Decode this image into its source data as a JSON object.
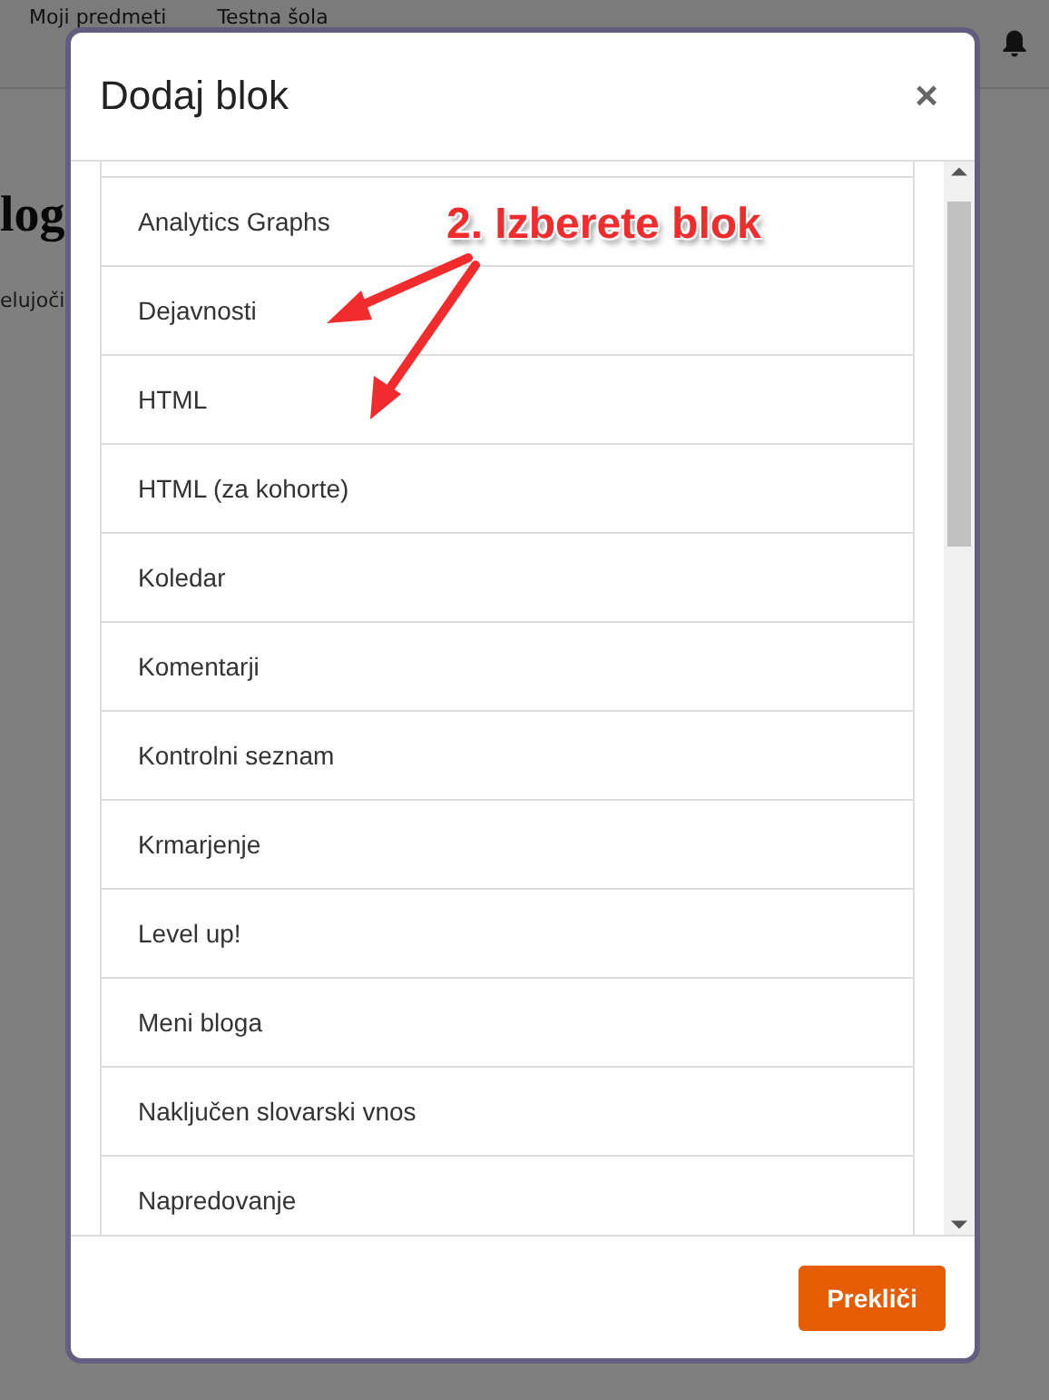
{
  "page": {
    "breadcrumb": [
      "Moji predmeti",
      "Testna šola"
    ],
    "heading": "log",
    "subtext": "elujoči"
  },
  "modal": {
    "title": "Dodaj blok",
    "close": "×",
    "blocks": [
      {
        "label": "Analytics Graphs"
      },
      {
        "label": "Dejavnosti"
      },
      {
        "label": "HTML"
      },
      {
        "label": "HTML (za kohorte)"
      },
      {
        "label": "Koledar"
      },
      {
        "label": "Komentarji"
      },
      {
        "label": "Kontrolni seznam"
      },
      {
        "label": "Krmarjenje"
      },
      {
        "label": "Level up!"
      },
      {
        "label": "Meni bloga"
      },
      {
        "label": "Naključen slovarski vnos"
      },
      {
        "label": "Napredovanje"
      }
    ],
    "cancel": "Prekliči"
  },
  "annotation": {
    "text": "2. Izberete blok"
  }
}
